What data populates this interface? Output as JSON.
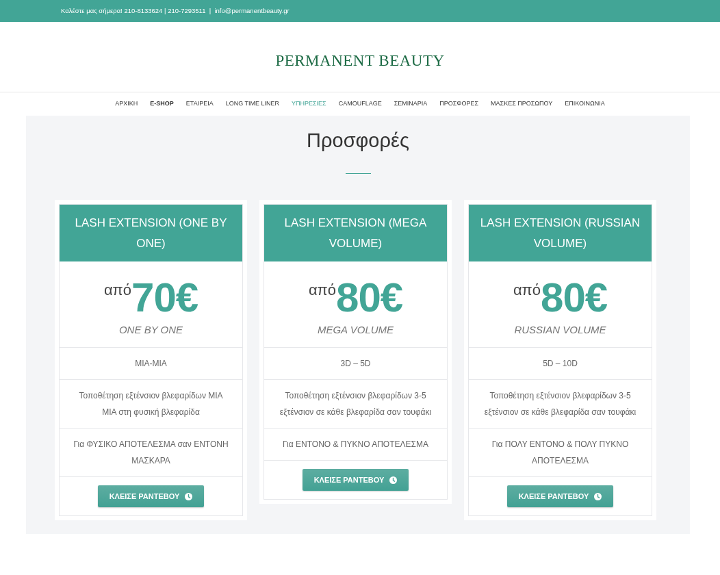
{
  "top_bar": {
    "text": "Καλέστε μας σήμερα! 210-8133624 | 210-7293511  |  info@permanentbeauty.gr"
  },
  "logo": {
    "text": "PERMANENT BEAUTY"
  },
  "nav": {
    "items": [
      {
        "label": "ΑΡΧΙΚΗ",
        "selected": false,
        "bold": false
      },
      {
        "label": "E-SHOP",
        "selected": false,
        "bold": true
      },
      {
        "label": "ΕΤΑΙΡΕΙΑ",
        "selected": false,
        "bold": false
      },
      {
        "label": "LONG TIME LINER",
        "selected": false,
        "bold": false
      },
      {
        "label": "ΥΠΗΡΕΣΙΕΣ",
        "selected": true,
        "bold": false
      },
      {
        "label": "CAMOUFLAGE",
        "selected": false,
        "bold": false
      },
      {
        "label": "ΣΕΜΙΝΑΡΙΑ",
        "selected": false,
        "bold": false
      },
      {
        "label": "ΠΡΟΣΦΟΡΕΣ",
        "selected": false,
        "bold": false
      },
      {
        "label": "ΜΑΣΚΕΣ ΠΡΟΣΩΠΟΥ",
        "selected": false,
        "bold": false
      },
      {
        "label": "ΕΠΙΚΟΙΝΩΝΙΑ",
        "selected": false,
        "bold": false
      }
    ]
  },
  "section": {
    "title": "Προσφορές"
  },
  "offers": [
    {
      "title": "LASH EXTENSION (ONE BY ONE)",
      "price_prefix": "από",
      "price": "70€",
      "subtitle": "ONE BY ONE",
      "features": [
        "ΜΙΑ-ΜΙΑ",
        "Τοποθέτηση εξτένσιον βλεφαρίδων ΜΙΑ ΜΙΑ στη φυσική βλεφαρίδα",
        "Για ΦΥΣΙΚΟ ΑΠΟΤΕΛΕΣΜΑ σαν ΕΝΤΟΝΗ ΜΑΣΚΑΡΑ"
      ],
      "button": "ΚΛΕΙΣΕ ΡΑΝΤΕΒΟΥ"
    },
    {
      "title": "LASH EXTENSION (MEGA VOLUME)",
      "price_prefix": "από",
      "price": "80€",
      "subtitle": "MEGA VOLUME",
      "features": [
        "3D – 5D",
        "Τοποθέτηση εξτένσιον βλεφαρίδων 3-5 εξτένσιον σε κάθε βλεφαρίδα σαν τουφάκι",
        "Για ΕΝΤΟΝΟ & ΠΥΚΝΟ ΑΠΟΤΕΛΕΣΜΑ"
      ],
      "button": "ΚΛΕΙΣΕ ΡΑΝΤΕΒΟΥ"
    },
    {
      "title": "LASH EXTENSION (RUSSIAN VOLUME)",
      "price_prefix": "από",
      "price": "80€",
      "subtitle": "RUSSIAN VOLUME",
      "features": [
        "5D – 10D",
        "Τοποθέτηση εξτένσιον βλεφαρίδων 3-5 εξτένσιον σε κάθε βλεφαρίδα σαν τουφάκι",
        "Για ΠΟΛΥ ΕΝΤΟΝΟ & ΠΟΛΥ ΠΥΚΝΟ ΑΠΟΤΕΛΕΣΜΑ"
      ],
      "button": "ΚΛΕΙΣΕ ΡΑΝΤΕΒΟΥ"
    }
  ]
}
